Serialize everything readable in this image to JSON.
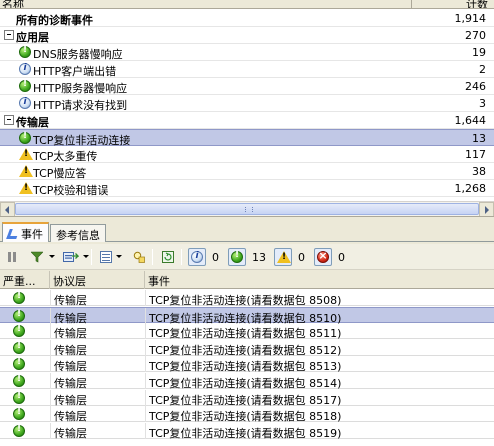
{
  "top_panel": {
    "header": {
      "name_col": "名称",
      "count_col": "计数"
    },
    "rows": [
      {
        "label": "所有的诊断事件",
        "count": "1,914",
        "kind": "total",
        "icon": "",
        "indent": 16
      },
      {
        "label": "应用层",
        "count": "270",
        "kind": "group",
        "icon": "",
        "indent": 16
      },
      {
        "label": "DNS服务器慢响应",
        "count": "19",
        "kind": "item",
        "icon": "ok",
        "indent": 33
      },
      {
        "label": "HTTP客户端出错",
        "count": "2",
        "kind": "item",
        "icon": "info",
        "indent": 33
      },
      {
        "label": "HTTP服务器慢响应",
        "count": "246",
        "kind": "item",
        "icon": "ok",
        "indent": 33
      },
      {
        "label": "HTTP请求没有找到",
        "count": "3",
        "kind": "item",
        "icon": "info",
        "indent": 33
      },
      {
        "label": "传输层",
        "count": "1,644",
        "kind": "group",
        "icon": "",
        "indent": 16
      },
      {
        "label": "TCP复位非活动连接",
        "count": "13",
        "kind": "item",
        "icon": "ok",
        "indent": 33,
        "selected": true
      },
      {
        "label": "TCP太多重传",
        "count": "117",
        "kind": "item",
        "icon": "warn",
        "indent": 33
      },
      {
        "label": "TCP慢应答",
        "count": "38",
        "kind": "item",
        "icon": "warn",
        "indent": 33
      },
      {
        "label": "TCP校验和错误",
        "count": "1,268",
        "kind": "item",
        "icon": "warn",
        "indent": 33
      }
    ]
  },
  "tabs": [
    {
      "label": "事件",
      "active": true
    },
    {
      "label": "参考信息",
      "active": false
    }
  ],
  "toolbar": {
    "filters": [
      {
        "icon": "info",
        "count": "0"
      },
      {
        "icon": "ok",
        "count": "13"
      },
      {
        "icon": "warn",
        "count": "0"
      },
      {
        "icon": "err",
        "count": "0"
      }
    ]
  },
  "grid": {
    "columns": [
      "严重...",
      "协议层",
      "事件"
    ],
    "rows": [
      {
        "severity": "ok",
        "layer": "传输层",
        "event": "TCP复位非活动连接(请看数据包 8508)"
      },
      {
        "severity": "ok",
        "layer": "传输层",
        "event": "TCP复位非活动连接(请看数据包 8510)",
        "selected": true
      },
      {
        "severity": "ok",
        "layer": "传输层",
        "event": "TCP复位非活动连接(请看数据包 8511)"
      },
      {
        "severity": "ok",
        "layer": "传输层",
        "event": "TCP复位非活动连接(请看数据包 8512)"
      },
      {
        "severity": "ok",
        "layer": "传输层",
        "event": "TCP复位非活动连接(请看数据包 8513)"
      },
      {
        "severity": "ok",
        "layer": "传输层",
        "event": "TCP复位非活动连接(请看数据包 8514)"
      },
      {
        "severity": "ok",
        "layer": "传输层",
        "event": "TCP复位非活动连接(请看数据包 8517)"
      },
      {
        "severity": "ok",
        "layer": "传输层",
        "event": "TCP复位非活动连接(请看数据包 8518)"
      },
      {
        "severity": "ok",
        "layer": "传输层",
        "event": "TCP复位非活动连接(请看数据包 8519)"
      }
    ]
  }
}
